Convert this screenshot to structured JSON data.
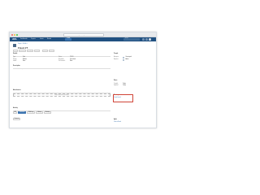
{
  "browser": {
    "url": "jira.example.com"
  },
  "navbar": {
    "logo": "JIRA",
    "items": [
      "Dashboards",
      "Projects",
      "Issues",
      "Boards"
    ],
    "create": "Create",
    "search_placeholder": "Search"
  },
  "issue": {
    "breadcrumb": "Project / ISSUE-1",
    "title": "Fixed JT",
    "operations": [
      "Edit",
      "Comment",
      "Assign",
      "More",
      "Start",
      "Done"
    ]
  },
  "details": {
    "heading": "Details",
    "fields": [
      {
        "label": "Type:",
        "value": "Task"
      },
      {
        "label": "Priority:",
        "value": "Medium"
      },
      {
        "label": "Labels:",
        "value": "None"
      },
      {
        "label": "Status:",
        "value": "TO DO"
      },
      {
        "label": "Resolution:",
        "value": "Unresolved"
      },
      {
        "label": "Fix Version/s:",
        "value": "None"
      }
    ]
  },
  "description": {
    "heading": "Description",
    "text": "Click to add description"
  },
  "attachments": {
    "heading": "Attachments",
    "drop_text": "Drop files to attach, or browse."
  },
  "activity": {
    "heading": "Activity",
    "tabs": [
      "All",
      "Comments",
      "Work Log",
      "History",
      "Activity"
    ],
    "comment_button": "Comment"
  },
  "people": {
    "heading": "People",
    "fields": [
      {
        "label": "Assignee:",
        "value": "Unassigned"
      },
      {
        "label": "Reporter:",
        "value": "Admin"
      }
    ]
  },
  "dates": {
    "heading": "Dates",
    "fields": [
      {
        "label": "Created:",
        "value": "Today"
      },
      {
        "label": "Updated:",
        "value": "Today"
      }
    ]
  },
  "development": {
    "heading": "Development",
    "link": "Create branch"
  },
  "agile": {
    "heading": "Agile",
    "link": "View on Board"
  },
  "colors": {
    "navbar": "#205081",
    "accent": "#3b73af",
    "highlight": "#d04437"
  }
}
